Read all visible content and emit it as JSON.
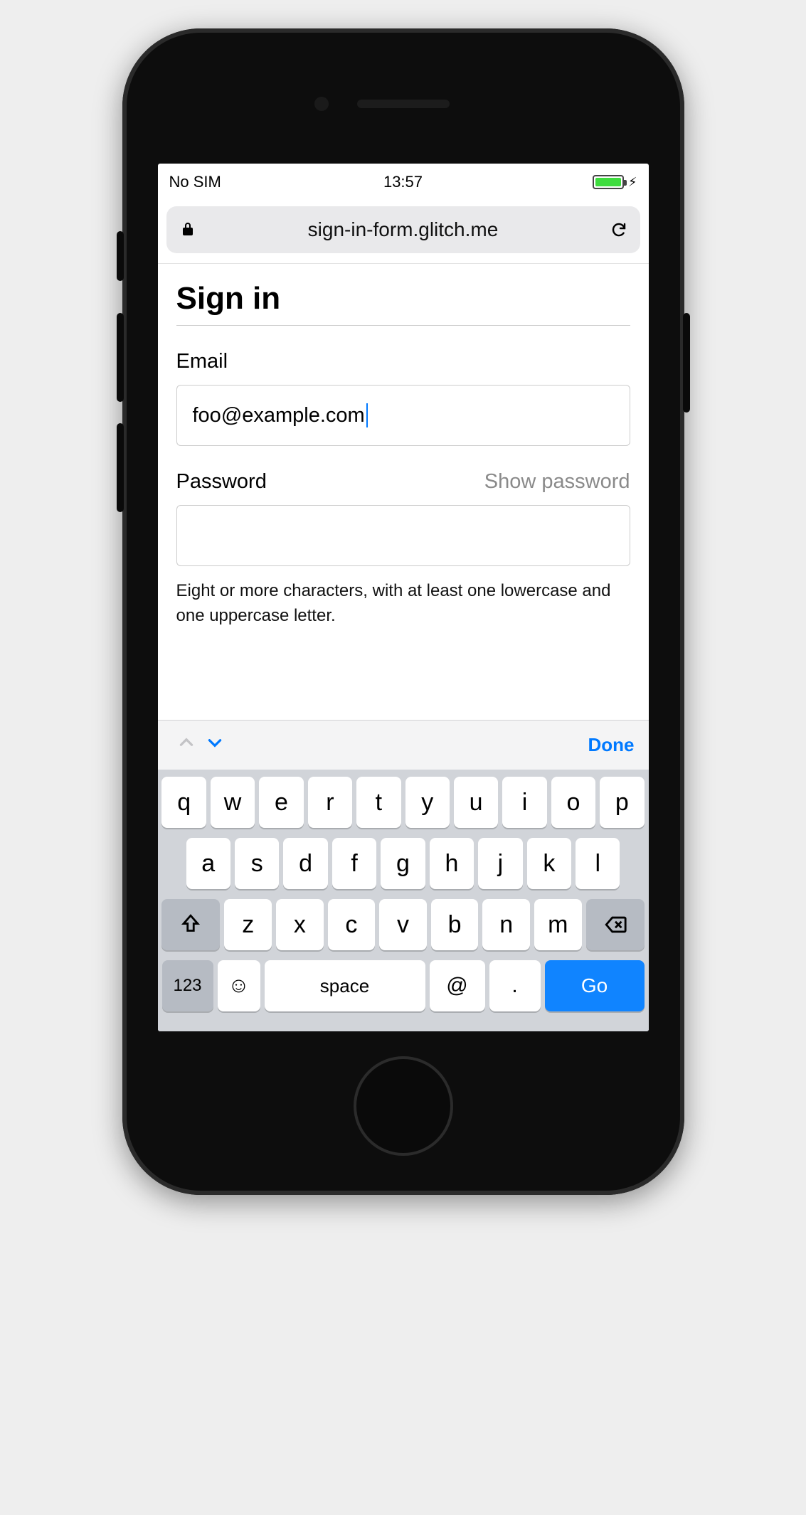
{
  "status_bar": {
    "carrier": "No SIM",
    "time": "13:57"
  },
  "browser": {
    "url": "sign-in-form.glitch.me"
  },
  "page": {
    "heading": "Sign in",
    "email": {
      "label": "Email",
      "value": "foo@example.com"
    },
    "password": {
      "label": "Password",
      "toggle_label": "Show password",
      "value": "",
      "hint": "Eight or more characters, with at least one lowercase and one uppercase letter."
    }
  },
  "keyboard": {
    "accessory": {
      "done": "Done"
    },
    "rows": {
      "r1": [
        "q",
        "w",
        "e",
        "r",
        "t",
        "y",
        "u",
        "i",
        "o",
        "p"
      ],
      "r2": [
        "a",
        "s",
        "d",
        "f",
        "g",
        "h",
        "j",
        "k",
        "l"
      ],
      "r3": [
        "z",
        "x",
        "c",
        "v",
        "b",
        "n",
        "m"
      ]
    },
    "bottom": {
      "numbers": "123",
      "space": "space",
      "at": "@",
      "dot": ".",
      "go": "Go"
    }
  }
}
